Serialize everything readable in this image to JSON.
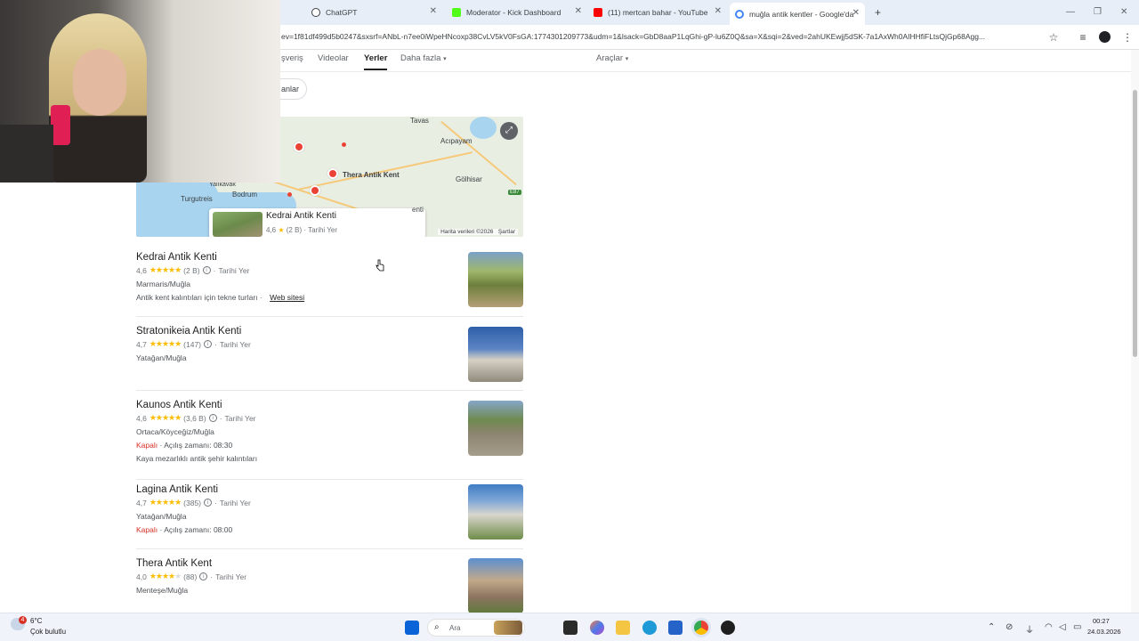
{
  "browser": {
    "tabs": [
      {
        "label": "ChatGPT",
        "active": false
      },
      {
        "label": "Moderator - Kick Dashboard",
        "active": false
      },
      {
        "label": "(11) mertcan bahar - YouTube",
        "active": false
      },
      {
        "label": "muğla antik kentler - Google'da",
        "active": true
      }
    ],
    "new_tab": "+",
    "url": "ev=1f81df499d5b0247&sxsrf=ANbL-n7ee0iWpeHNcoxp38CvLV5kV0FsGA:1774301209773&udm=1&lsack=GbD8aaP1LqGhi-gP-lu6Z0Q&sa=X&sqi=2&ved=2ahUKEwjj5dSK-7a1AxWh0AIHHfiFLtsQjGp68Agg..."
  },
  "search_nav": {
    "items": [
      "şveriş",
      "Videolar",
      "Yerler",
      "Daha fazla",
      "Araçlar"
    ],
    "active": "Yerler"
  },
  "filter_chip": "anlar",
  "map": {
    "cities": [
      "Tavas",
      "Acıpayam",
      "Gölhisar",
      "Yalıkavak",
      "Bodrum",
      "Turgutreis",
      "Thera Antik Kent"
    ],
    "road_badge": "E87",
    "card": {
      "name": "Kedrai Antik Kenti",
      "rating": "4,6",
      "stars": "★",
      "reviews": "(2 B)",
      "type": "Tarihi Yer",
      "cut_label": "enti"
    },
    "footer": [
      "Harita verileri ©2026",
      "Şartlar"
    ]
  },
  "results": [
    {
      "name": "Kedrai Antik Kenti",
      "rating": "4,6",
      "stars": "★★★★★",
      "reviews": "(2 B)",
      "type": "Tarihi Yer",
      "location": "Marmaris/Muğla",
      "extra": "Antik kent kalıntıları için tekne turları",
      "link": "Web sitesi"
    },
    {
      "name": "Stratonikeia Antik Kenti",
      "rating": "4,7",
      "stars": "★★★★★",
      "reviews": "(147)",
      "type": "Tarihi Yer",
      "location": "Yatağan/Muğla"
    },
    {
      "name": "Kaunos Antik Kenti",
      "rating": "4,6",
      "stars": "★★★★★",
      "reviews": "(3,6 B)",
      "type": "Tarihi Yer",
      "location": "Ortaca/Köyceğiz/Muğla",
      "status": "Kapalı",
      "hours": "· Açılış zamanı: 08:30",
      "extra": "Kaya mezarlıklı antik şehir kalıntıları"
    },
    {
      "name": "Lagina Antik Kenti",
      "rating": "4,7",
      "stars": "★★★★★",
      "reviews": "(385)",
      "type": "Tarihi Yer",
      "location": "Yatağan/Muğla",
      "status": "Kapalı",
      "hours": "· Açılış zamanı: 08:00"
    },
    {
      "name": "Thera Antik Kent",
      "rating": "4,0",
      "stars": "★★★★★",
      "reviews": "(88)",
      "type": "Tarihi Yer",
      "location": "Menteşe/Muğla"
    }
  ],
  "taskbar": {
    "weather_temp": "6°C",
    "weather_desc": "Çok bulutlu",
    "search_placeholder": "Ara",
    "time": "00:27",
    "date": "24.03.2026",
    "notif_badge": "4"
  }
}
